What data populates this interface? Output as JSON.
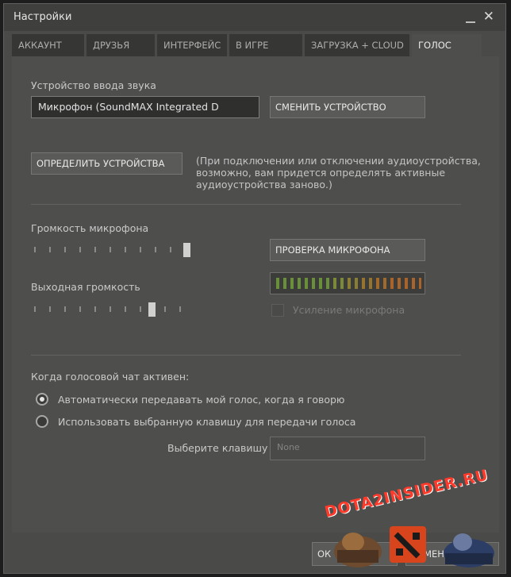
{
  "window": {
    "title": "Настройки"
  },
  "tabs": [
    {
      "label": "АККАУНТ"
    },
    {
      "label": "ДРУЗЬЯ"
    },
    {
      "label": "ИНТЕРФЕЙС"
    },
    {
      "label": "В ИГРЕ"
    },
    {
      "label": "ЗАГРУЗКА + CLOUD"
    },
    {
      "label": "ГОЛОС",
      "active": true
    }
  ],
  "voice": {
    "input_device_label": "Устройство ввода звука",
    "input_device_value": "Микрофон (SoundMAX Integrated D",
    "change_device_button": "СМЕНИТЬ УСТРОЙСТВО",
    "detect_devices_button": "ОПРЕДЕЛИТЬ УСТРОЙСТВА",
    "detect_note": "(При подключении или отключении аудиоустройства, возможно, вам придется определять активные аудиоустройства заново.)",
    "mic_volume_label": "Громкость микрофона",
    "mic_volume_level": 1.0,
    "test_mic_button": "ПРОВЕРКА МИКРОФОНА",
    "output_volume_label": "Выходная громкость",
    "output_volume_level": 0.75,
    "mic_boost_label": "Усиление микрофона",
    "mic_boost_checked": false,
    "when_active_label": "Когда голосовой чат активен:",
    "radio_auto_label": "Автоматически передавать мой голос, когда я говорю",
    "radio_key_label": "Использовать выбранную клавишу для передачи голоса",
    "select_key_label": "Выберите клавишу",
    "select_key_value": "None"
  },
  "footer": {
    "ok_button": "ОК",
    "cancel_button": "ОТМЕНА"
  },
  "watermark": {
    "text": "DOTA2INSIDER.RU"
  },
  "colors": {
    "meter_green": "#6a8f3a",
    "meter_orange": "#a8642a",
    "watermark_red": "#ff3a2a"
  }
}
